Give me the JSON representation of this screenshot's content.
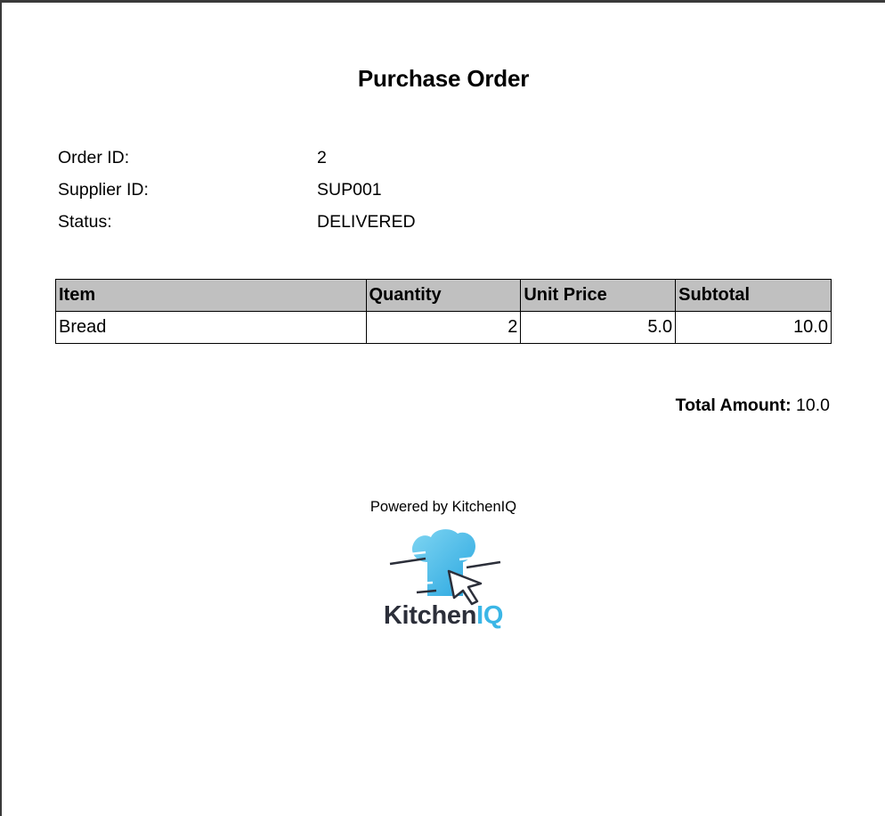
{
  "document": {
    "title": "Purchase Order",
    "meta": [
      {
        "label": "Order ID:",
        "value": "2"
      },
      {
        "label": "Supplier ID:",
        "value": "SUP001"
      },
      {
        "label": "Status:",
        "value": "DELIVERED"
      }
    ],
    "table": {
      "headers": [
        "Item",
        "Quantity",
        "Unit Price",
        "Subtotal"
      ],
      "rows": [
        [
          "Bread",
          "2",
          "5.0",
          "10.0"
        ]
      ]
    },
    "total": {
      "label": "Total Amount:",
      "value": "10.0"
    },
    "footer": {
      "powered_by": "Powered by KitchenIQ",
      "logo_icon": "chef-hat-cursor-icon",
      "logo_word_main": "Kitchen",
      "logo_word_accent": "IQ",
      "colors": {
        "logo_blue": "#3bb6e6",
        "logo_dark": "#2c2f3a",
        "header_bg": "#c0c0c0"
      }
    }
  }
}
